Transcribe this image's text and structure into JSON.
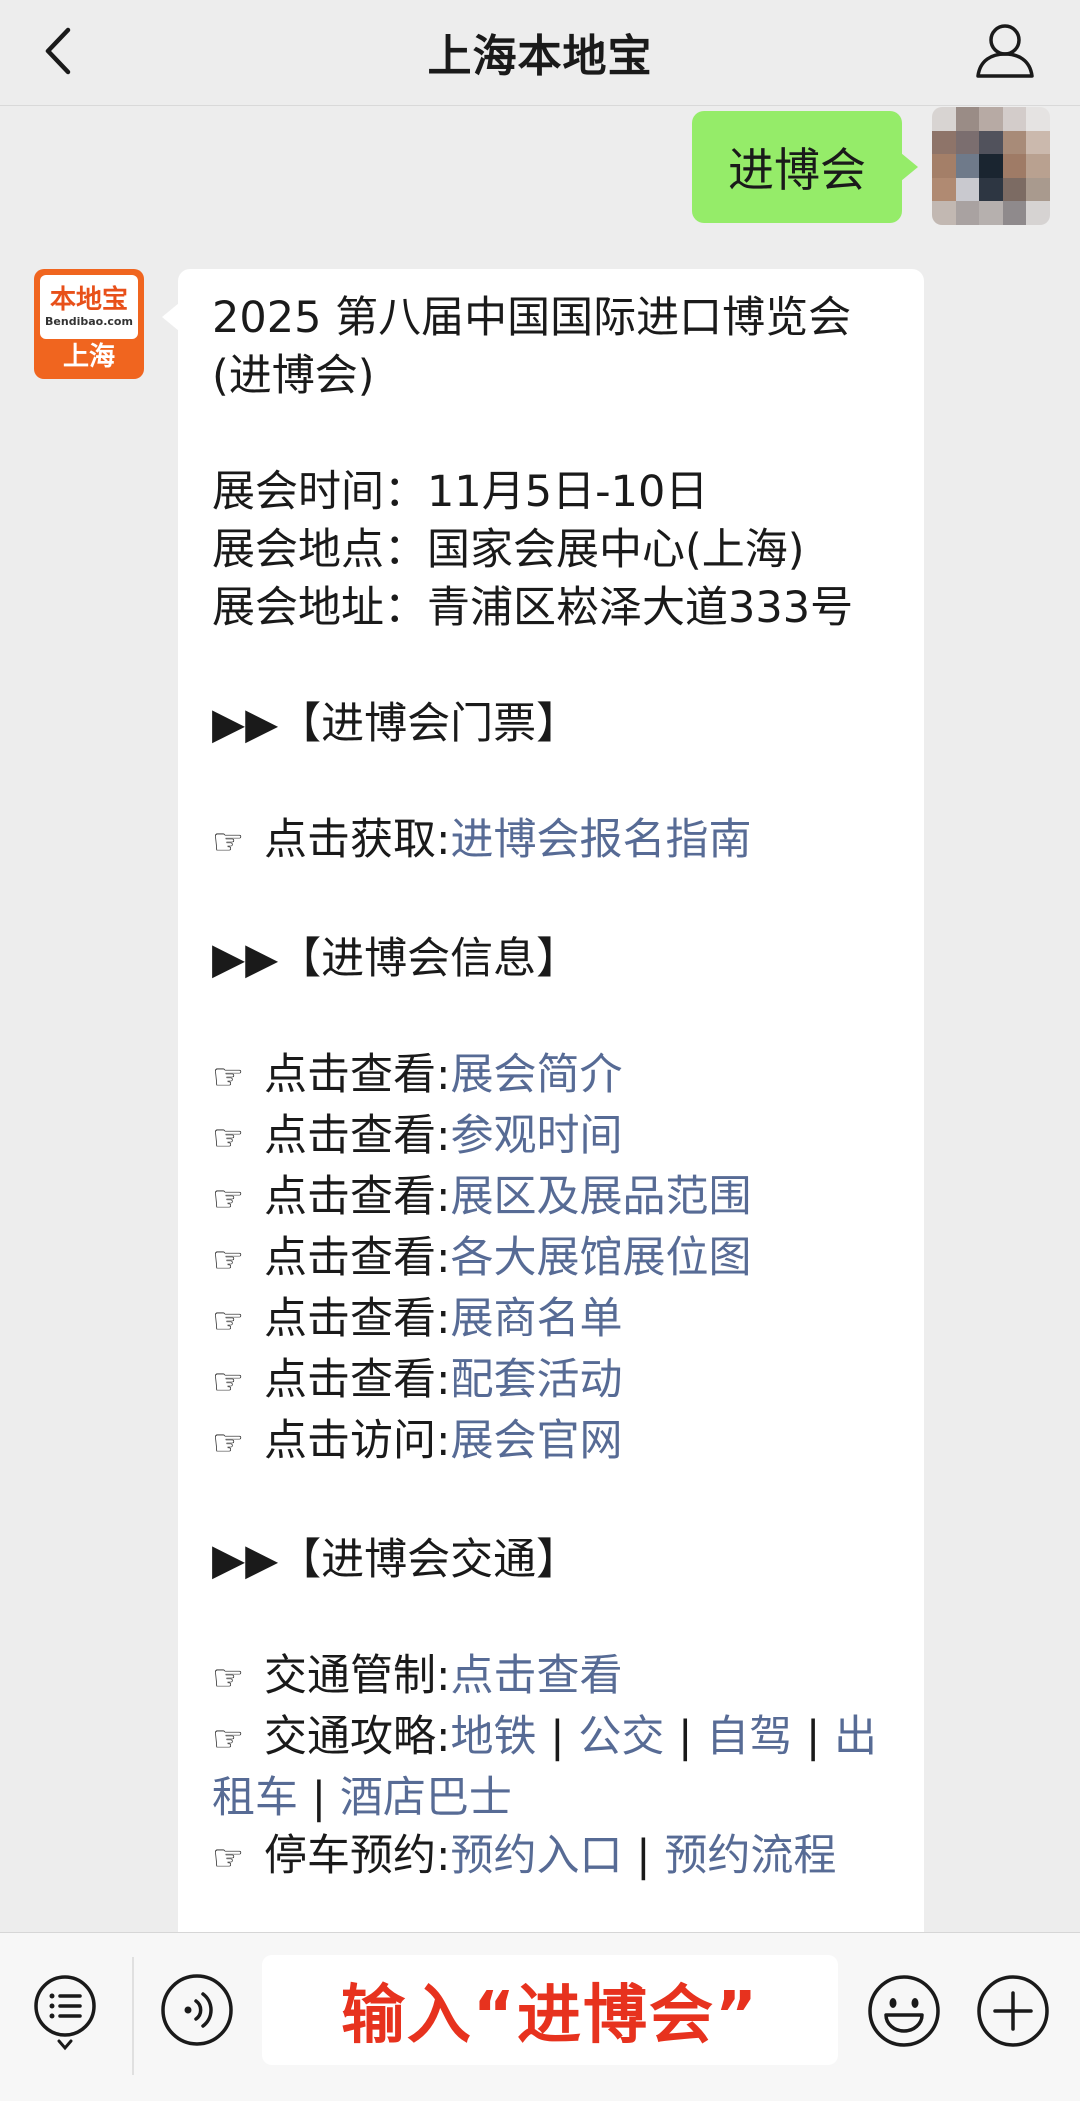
{
  "header": {
    "title": "上海本地宝"
  },
  "outgoing": {
    "text": "进博会"
  },
  "bot": {
    "avatar_brand": "本地宝",
    "avatar_url": "Bendibao.com",
    "avatar_city": "上海"
  },
  "message": {
    "title": "2025 第八届中国国际进口博览会(进博会)",
    "time": "展会时间：11月5日-10日",
    "venue": "展会地点：国家会展中心(上海)",
    "address": "展会地址：青浦区崧泽大道333号",
    "hand": "☞",
    "section_tickets": "▶▶【进博会门票】",
    "ticket_label": "点击获取:",
    "ticket_link": "进博会报名指南",
    "section_info": "▶▶【进博会信息】",
    "info_items": [
      {
        "label": "点击查看:",
        "link": "展会简介"
      },
      {
        "label": "点击查看:",
        "link": "参观时间"
      },
      {
        "label": "点击查看:",
        "link": "展区及展品范围"
      },
      {
        "label": "点击查看:",
        "link": "各大展馆展位图"
      },
      {
        "label": "点击查看:",
        "link": "展商名单"
      },
      {
        "label": "点击查看:",
        "link": "配套活动"
      },
      {
        "label": "点击访问:",
        "link": "展会官网"
      }
    ],
    "section_traffic": "▶▶【进博会交通】",
    "traffic_control_label": "交通管制:",
    "traffic_control_link": "点击查看",
    "traffic_guide_label": "交通攻略:",
    "traffic_guide_links": [
      "地铁",
      "公交",
      "自驾",
      "出租车",
      "酒店巴士"
    ],
    "separator": " | ",
    "parking_label": "停车预约:",
    "parking_links": [
      "预约入口",
      "预约流程"
    ]
  },
  "input": {
    "text": "输入“进博会”"
  },
  "colors": {
    "link": "#576b95",
    "outgoing_bubble": "#95ec69",
    "input_text": "#e7321e",
    "brand_orange": "#f0651f"
  },
  "icons": [
    "back-arrow-icon",
    "profile-icon",
    "menu-list-icon",
    "voice-icon",
    "emoji-icon",
    "plus-icon"
  ]
}
